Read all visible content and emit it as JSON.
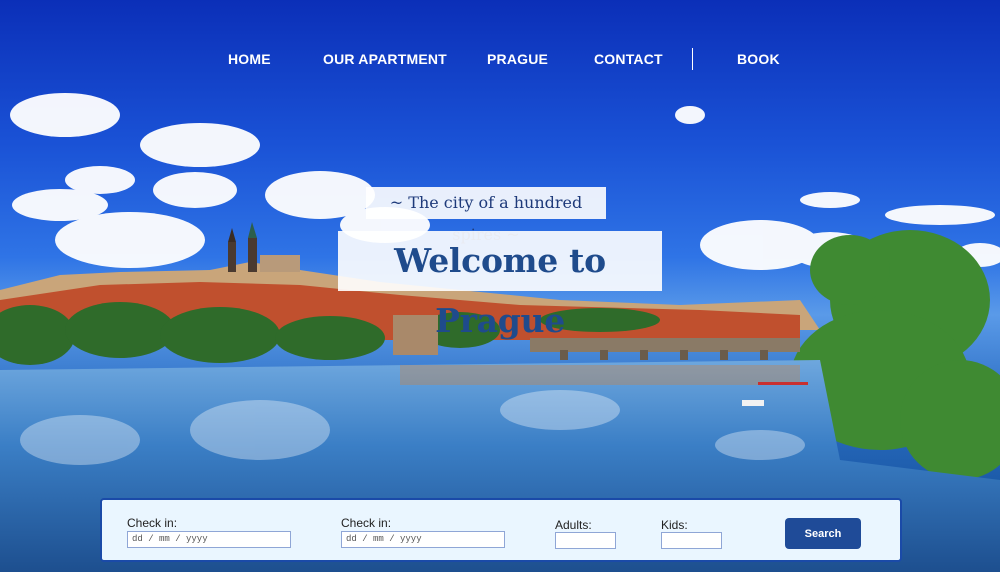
{
  "nav": {
    "items": [
      {
        "label": "HOME"
      },
      {
        "label": "OUR APARTMENT"
      },
      {
        "label": "PRAGUE"
      },
      {
        "label": "CONTACT"
      },
      {
        "label": "BOOK"
      }
    ]
  },
  "hero": {
    "tagline": "~ The city of a hundred spires ~",
    "headline": "Welcome to Prague"
  },
  "booking": {
    "checkin_label": "Check in:",
    "checkin_placeholder": "dd / mm / yyyy",
    "checkout_label": "Check in:",
    "checkout_placeholder": "dd / mm / yyyy",
    "adults_label": "Adults:",
    "kids_label": "Kids:",
    "search_label": "Search"
  },
  "colors": {
    "sky": "#1a52d6",
    "headline": "#1f4b8c",
    "button": "#1f4b98"
  }
}
